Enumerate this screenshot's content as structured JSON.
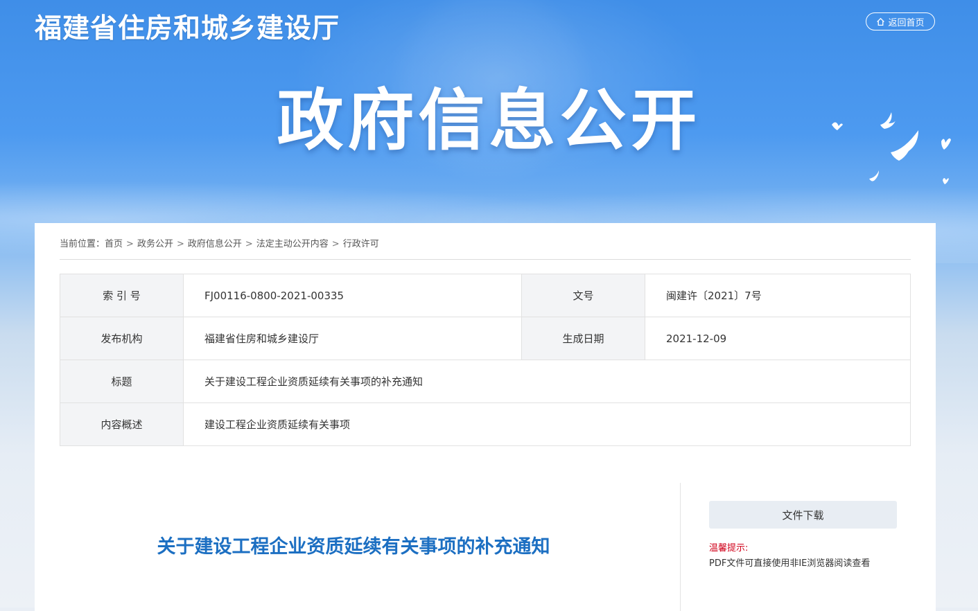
{
  "header": {
    "site_title": "福建省住房和城乡建设厅",
    "home_button": "返回首页",
    "hero_title": "政府信息公开"
  },
  "breadcrumb": {
    "prefix": "当前位置：",
    "items": [
      "首页",
      "政务公开",
      "政府信息公开",
      "法定主动公开内容",
      "行政许可"
    ],
    "separator": ">"
  },
  "info": {
    "index_label": "索 引 号",
    "index_value": "FJ00116-0800-2021-00335",
    "doc_no_label": "文号",
    "doc_no_value": "闽建许〔2021〕7号",
    "issuer_label": "发布机构",
    "issuer_value": "福建省住房和城乡建设厅",
    "date_label": "生成日期",
    "date_value": "2021-12-09",
    "title_label": "标题",
    "title_value": "关于建设工程企业资质延续有关事项的补充通知",
    "summary_label": "内容概述",
    "summary_value": "建设工程企业资质延续有关事项"
  },
  "document": {
    "title": "关于建设工程企业资质延续有关事项的补充通知"
  },
  "sidebar": {
    "download_button": "文件下载",
    "tip_label": "温馨提示:",
    "tip_text": "PDF文件可直接使用非IE浏览器阅读查看"
  },
  "colors": {
    "banner_blue": "#4d9af0",
    "title_blue": "#1c6fc2",
    "tip_red": "#d0021b"
  }
}
